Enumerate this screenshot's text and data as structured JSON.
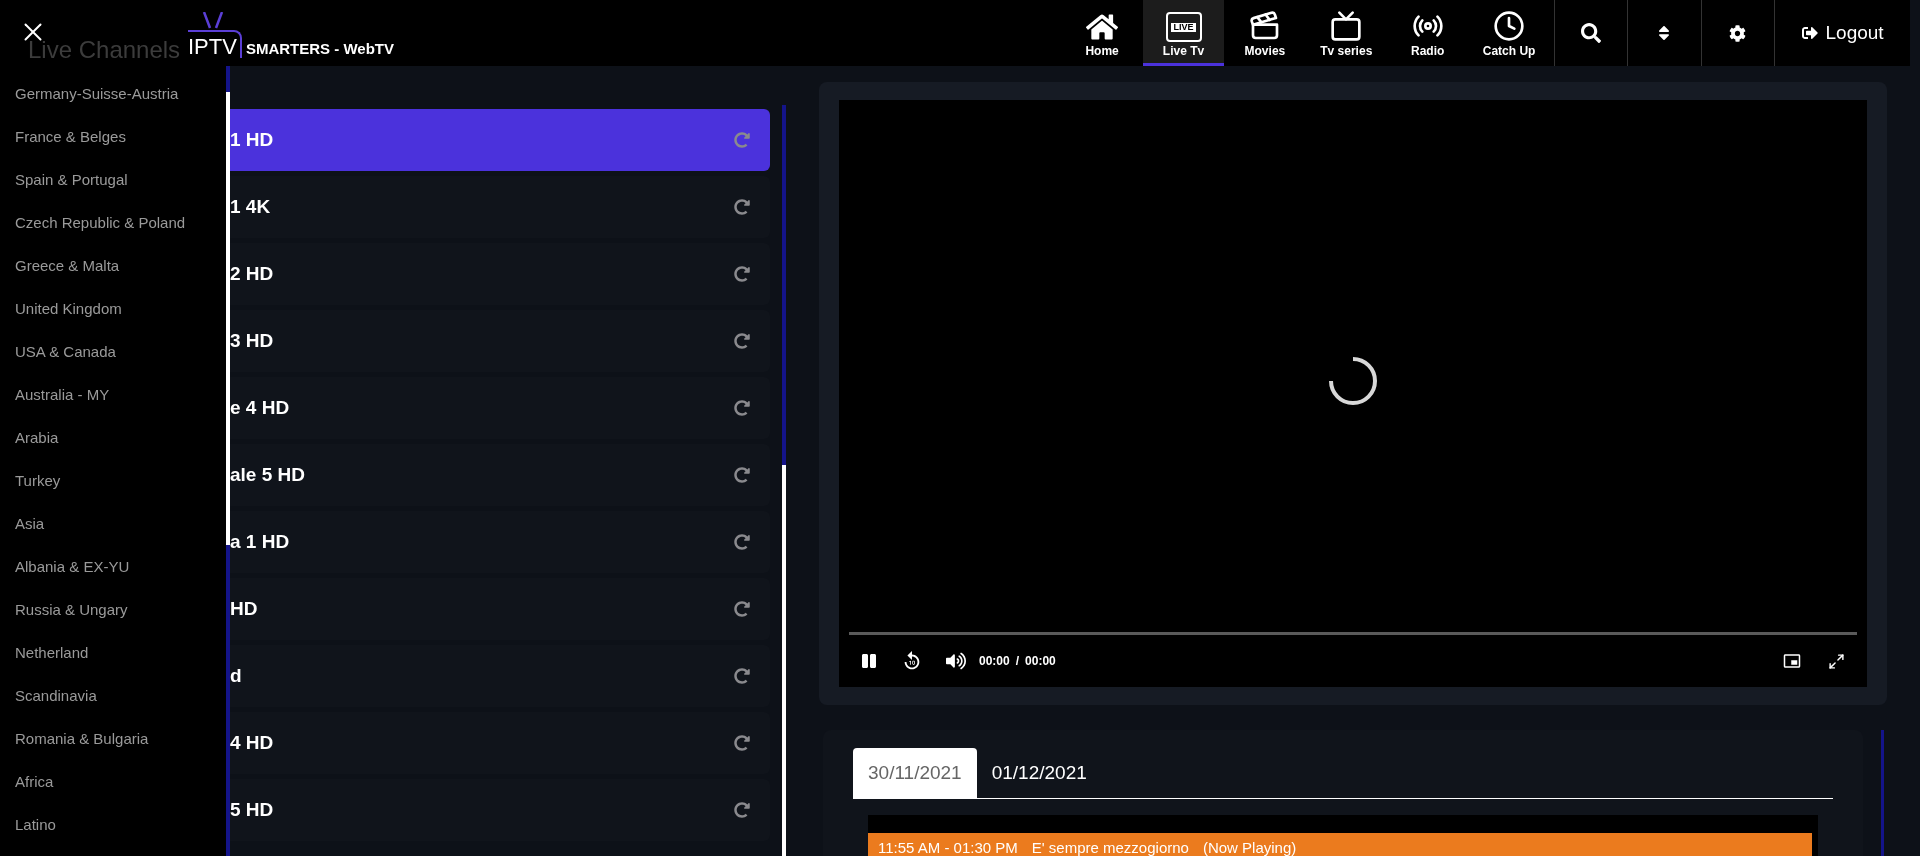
{
  "header": {
    "logo": {
      "prefix": "IPTV",
      "name": "SMARTERS - WebTV"
    },
    "sidebar_title": "Live Channels",
    "nav": [
      {
        "label": "Home",
        "selected": false
      },
      {
        "label": "Live Tv",
        "badge": "LIVE",
        "selected": true
      },
      {
        "label": "Movies",
        "selected": false
      },
      {
        "label": "Tv series",
        "selected": false
      },
      {
        "label": "Radio",
        "selected": false
      },
      {
        "label": "Catch Up",
        "selected": false
      }
    ],
    "tools": [
      {
        "kind": "search"
      },
      {
        "kind": "sort"
      },
      {
        "kind": "settings"
      }
    ],
    "logout": "Logout"
  },
  "categories": [
    "Germany-Suisse-Austria",
    "France & Belges",
    "Spain & Portugal",
    "Czech Republic & Poland",
    "Greece & Malta",
    "United Kingdom",
    "USA & Canada",
    "Australia - MY",
    "Arabia",
    "Turkey",
    "Asia",
    "Albania & EX-YU",
    "Russia & Ungary",
    "Netherland",
    "Scandinavia",
    "Romania & Bulgaria",
    "Africa",
    "Latino"
  ],
  "channels": [
    {
      "name": "1 HD",
      "selected": true
    },
    {
      "name": "1 4K",
      "selected": false
    },
    {
      "name": "2 HD",
      "selected": false
    },
    {
      "name": "3 HD",
      "selected": false
    },
    {
      "name": "e 4 HD",
      "selected": false
    },
    {
      "name": "ale 5 HD",
      "selected": false
    },
    {
      "name": "a 1 HD",
      "selected": false
    },
    {
      "name": "HD",
      "selected": false
    },
    {
      "name": "d",
      "selected": false
    },
    {
      "name": "4 HD",
      "selected": false
    },
    {
      "name": "5 HD",
      "selected": false
    }
  ],
  "player": {
    "playing": true,
    "level": 0,
    "current_time": "00:00",
    "separator": "/",
    "duration": "00:00"
  },
  "epg": {
    "dates": [
      {
        "label": "30/11/2021",
        "selected": true
      },
      {
        "label": "01/12/2021",
        "selected": false
      }
    ],
    "programmes": [
      {
        "time": "11:55 AM - 01:30 PM",
        "title": "E' sempre mezzogiorno",
        "status": "(Now Playing)",
        "now_playing": true
      }
    ]
  }
}
